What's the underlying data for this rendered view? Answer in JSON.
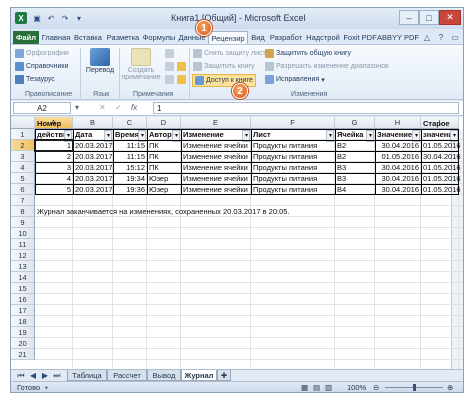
{
  "window": {
    "title": "Книга1 [Общий] - Microsoft Excel",
    "minimize": "–",
    "maximize": "□",
    "close": "✕"
  },
  "ribbon_tabs": [
    "Файл",
    "Главная",
    "Вставка",
    "Разметка",
    "Формулы",
    "Данные",
    "Рецензир",
    "Вид",
    "Разработ",
    "Надстрой",
    "Foxit PDF",
    "ABBYY PDF"
  ],
  "ribbon": {
    "proofing": {
      "spelling": "Орфография",
      "thesaurus_ref": "Справочники",
      "thesaurus": "Тезаурус",
      "label": "Правописание"
    },
    "language": {
      "translate": "Перевод",
      "label": "Язык"
    },
    "comments": {
      "new_comment_1": "Создать",
      "new_comment_2": "примечание",
      "label": "Примечания"
    },
    "changes": {
      "unprotect_sheet": "Снять защиту листа",
      "protect_book": "Защитить книгу",
      "share_book": "Доступ к книге",
      "protect_share": "Защитить общую книгу",
      "allow_ranges": "Разрешить изменение диапазонов",
      "track_changes": "Исправления",
      "label": "Изменения"
    }
  },
  "callouts": {
    "one": "1",
    "two": "2"
  },
  "formula_bar": {
    "name_box": "A2",
    "fx": "fx",
    "value": "1"
  },
  "columns": [
    "A",
    "B",
    "C",
    "D",
    "E",
    "F",
    "G",
    "H",
    "I"
  ],
  "row_numbers": [
    "1",
    "2",
    "3",
    "4",
    "5",
    "6",
    "7",
    "8",
    "9",
    "10",
    "11",
    "12",
    "13",
    "14",
    "15",
    "16",
    "17",
    "18",
    "19",
    "20",
    "21"
  ],
  "table": {
    "header_top": {
      "a": "Номер",
      "i": "Старое"
    },
    "header": {
      "a": "действия",
      "b": "Дата",
      "c": "Время",
      "d": "Автор",
      "e": "Изменение",
      "f": "Лист",
      "g": "Ячейка",
      "h": "Значение",
      "i": "значение"
    },
    "rows": [
      [
        "1",
        "20.03.2017",
        "11:15",
        "ПК",
        "Изменение ячейки",
        "Продукты питания",
        "B2",
        "30.04.2016",
        "01.05.2016"
      ],
      [
        "2",
        "20.03.2017",
        "11:15",
        "ПК",
        "Изменение ячейки",
        "Продукты питания",
        "B2",
        "01.05.2016",
        "30.04.2016"
      ],
      [
        "3",
        "20.03.2017",
        "15:12",
        "ПК",
        "Изменение ячейки",
        "Продукты питания",
        "B3",
        "30.04.2016",
        "01.05.2016"
      ],
      [
        "4",
        "20.03.2017",
        "19:34",
        "Юзер",
        "Изменение ячейки",
        "Продукты питания",
        "B3",
        "30.04.2016",
        "01.05.2016"
      ],
      [
        "5",
        "20.03.2017",
        "19:36",
        "Юзер",
        "Изменение ячейки",
        "Продукты питания",
        "B4",
        "30.04.2016",
        "01.05.2016"
      ]
    ]
  },
  "journal_note": "Журнал заканчивается на изменениях, сохраненных 20.03.2017 в 20:05.",
  "sheet_tabs": [
    "Таблица",
    "Рассчет",
    "Вывод",
    "Журнал"
  ],
  "active_sheet": "Журнал",
  "status": {
    "ready": "Готово",
    "zoom": "100%"
  },
  "colors": {
    "accent": "#2a6e3a",
    "highlight": "#fde29b",
    "callout": "#e06a2b"
  }
}
